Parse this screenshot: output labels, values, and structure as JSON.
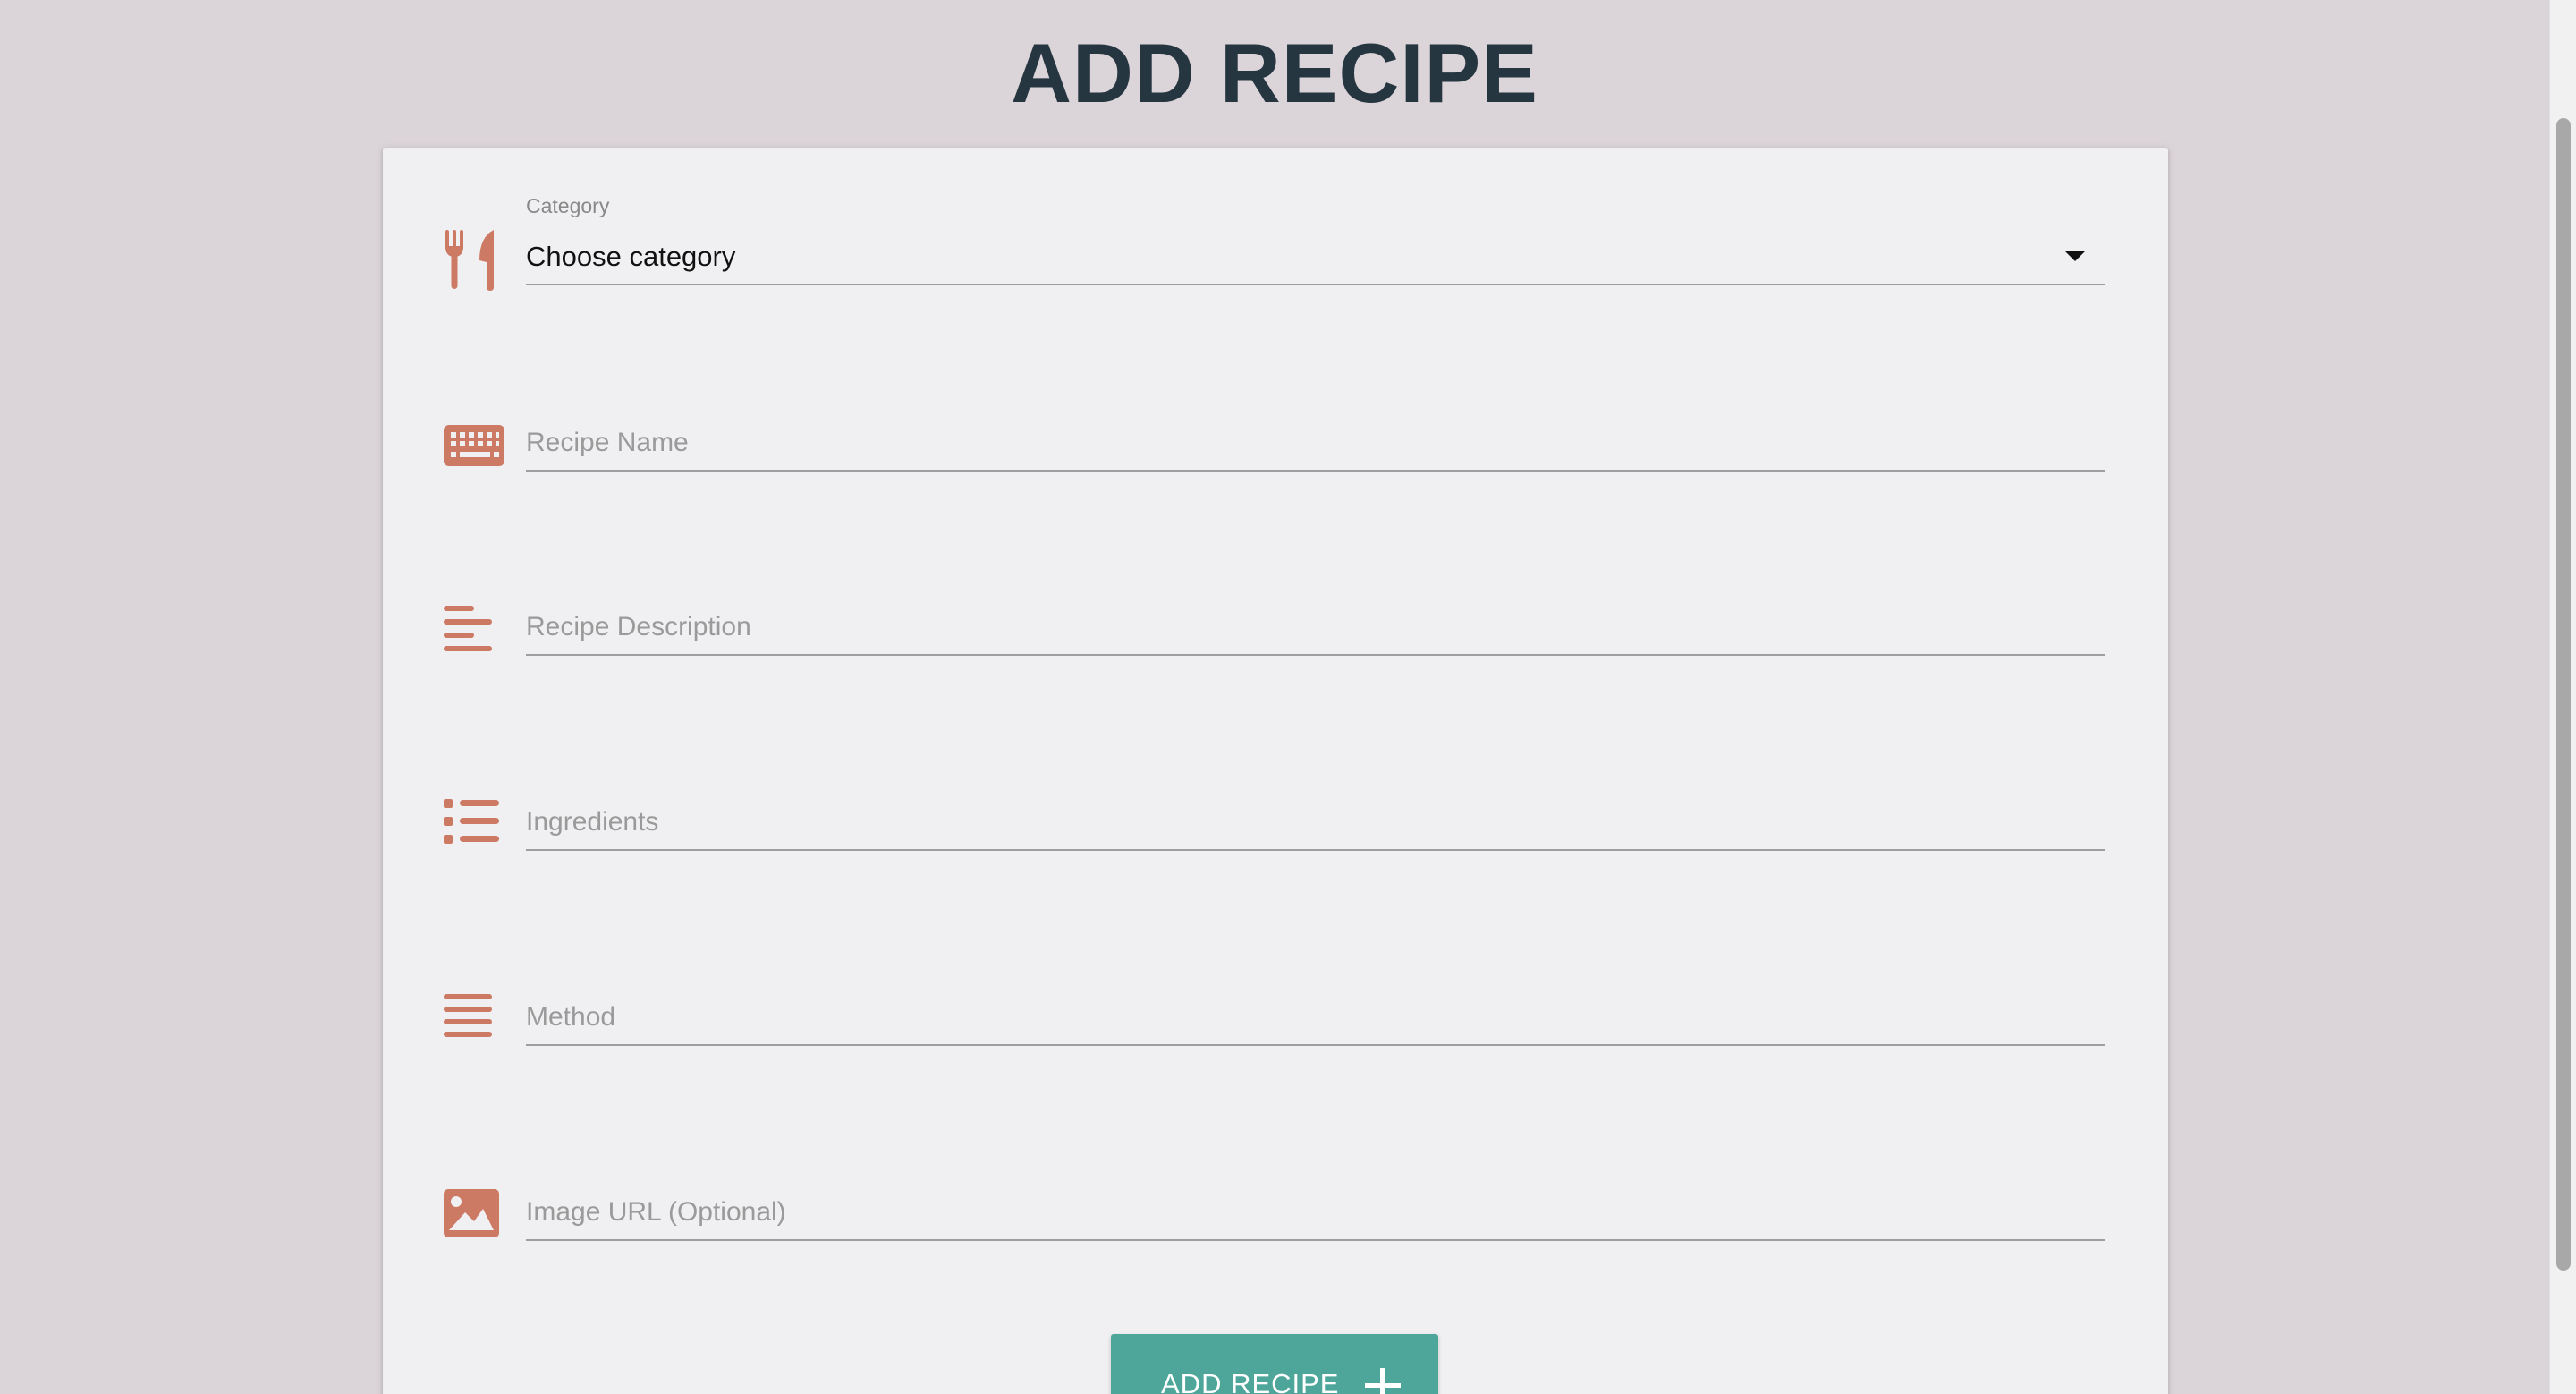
{
  "page": {
    "title": "ADD RECIPE"
  },
  "colors": {
    "icon": "#cd7a64",
    "accent_button": "#4ea69b",
    "title": "#263641",
    "background": "#dbd4d8"
  },
  "form": {
    "category": {
      "label": "Category",
      "selected": "Choose category",
      "icon": "utensils-icon"
    },
    "recipe_name": {
      "placeholder": "Recipe Name",
      "icon": "keyboard-icon"
    },
    "recipe_description": {
      "placeholder": "Recipe Description",
      "icon": "align-left-icon"
    },
    "ingredients": {
      "placeholder": "Ingredients",
      "icon": "list-icon"
    },
    "method": {
      "placeholder": "Method",
      "icon": "align-justify-icon"
    },
    "image_url": {
      "placeholder": "Image URL (Optional)",
      "icon": "image-icon"
    },
    "submit": {
      "label": "ADD RECIPE",
      "icon": "plus-icon"
    }
  }
}
